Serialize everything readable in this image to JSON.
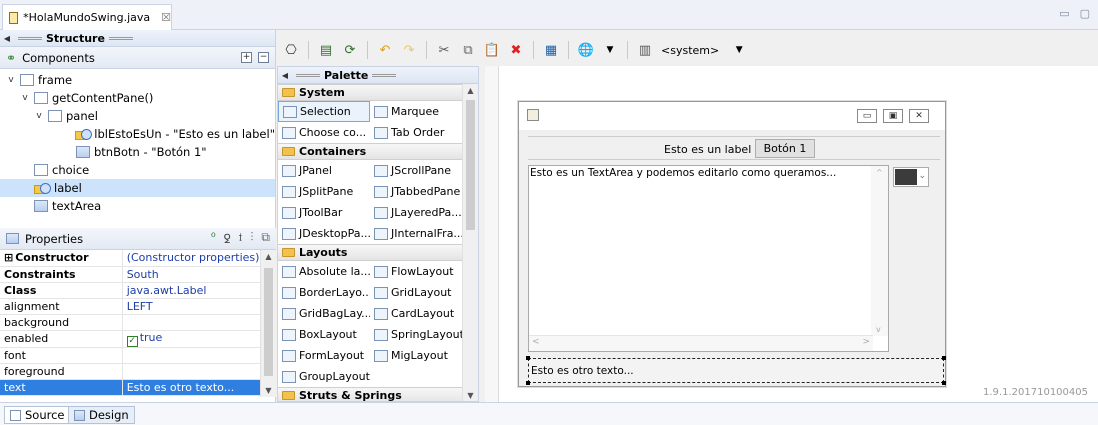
{
  "editor": {
    "tab_title": "*HolaMundoSwing.java",
    "tab_close": "☒",
    "minimize": "▭",
    "maximize": "▢"
  },
  "structure": {
    "strip_title": "Structure",
    "components_title": "Components",
    "tree": [
      {
        "label": "frame",
        "indent": 0,
        "expander": "v",
        "icon": "window-icon"
      },
      {
        "label": "getContentPane()",
        "indent": 1,
        "expander": "v",
        "icon": "content-pane-icon"
      },
      {
        "label": "panel",
        "indent": 2,
        "expander": "v",
        "icon": "panel-icon"
      },
      {
        "label": "lblEstoEsUn - \"Esto es un label\"",
        "indent": 4,
        "expander": "",
        "icon": "label-icon"
      },
      {
        "label": "btnBotn - \"Botón 1\"",
        "indent": 4,
        "expander": "",
        "icon": "button-icon"
      },
      {
        "label": "choice",
        "indent": 1,
        "expander": "",
        "icon": "choice-icon"
      },
      {
        "label": "label",
        "indent": 1,
        "expander": "",
        "icon": "label-icon",
        "selected": true
      },
      {
        "label": "textArea",
        "indent": 1,
        "expander": "",
        "icon": "textarea-icon"
      }
    ]
  },
  "properties": {
    "title": "Properties",
    "rows": [
      {
        "key": "Constructor",
        "value": "(Constructor properties)",
        "bold": true,
        "expander": "⊞"
      },
      {
        "key": "Constraints",
        "value": "South",
        "bold": true
      },
      {
        "key": "Class",
        "value": "java.awt.Label",
        "bold": true
      },
      {
        "key": "alignment",
        "value": "LEFT"
      },
      {
        "key": "background",
        "value": "",
        "dots": true
      },
      {
        "key": "enabled",
        "value": "true",
        "check": true
      },
      {
        "key": "font",
        "value": "",
        "dots": true
      },
      {
        "key": "foreground",
        "value": "",
        "dots": true
      },
      {
        "key": "text",
        "value": "Esto es otro texto...",
        "dots": true,
        "selected": true
      }
    ]
  },
  "toolbar": {
    "system_combo": "<system>"
  },
  "palette": {
    "strip_title": "Palette",
    "categories": [
      {
        "name": "System",
        "items": [
          {
            "label": "Selection",
            "selected": true
          },
          {
            "label": "Marquee"
          },
          {
            "label": "Choose co..."
          },
          {
            "label": "Tab Order"
          }
        ]
      },
      {
        "name": "Containers",
        "items": [
          {
            "label": "JPanel"
          },
          {
            "label": "JScrollPane"
          },
          {
            "label": "JSplitPane"
          },
          {
            "label": "JTabbedPane"
          },
          {
            "label": "JToolBar"
          },
          {
            "label": "JLayeredPa..."
          },
          {
            "label": "JDesktopPa..."
          },
          {
            "label": "JInternalFra..."
          }
        ]
      },
      {
        "name": "Layouts",
        "items": [
          {
            "label": "Absolute la..."
          },
          {
            "label": "FlowLayout"
          },
          {
            "label": "BorderLayo..."
          },
          {
            "label": "GridLayout"
          },
          {
            "label": "GridBagLay..."
          },
          {
            "label": "CardLayout"
          },
          {
            "label": "BoxLayout"
          },
          {
            "label": "SpringLayout"
          },
          {
            "label": "FormLayout"
          },
          {
            "label": "MigLayout"
          },
          {
            "label": "GroupLayout"
          }
        ]
      },
      {
        "name": "Struts & Springs",
        "items": []
      }
    ]
  },
  "design": {
    "label_text": "Esto es un label",
    "button_text": "Botón 1",
    "textarea_text": "Esto es un TextArea y podemos editarlo como queramos...",
    "south_label_text": "Esto es otro texto...",
    "version": "1.9.1.201710100405"
  },
  "bottom_tabs": {
    "source": "Source",
    "design": "Design"
  }
}
